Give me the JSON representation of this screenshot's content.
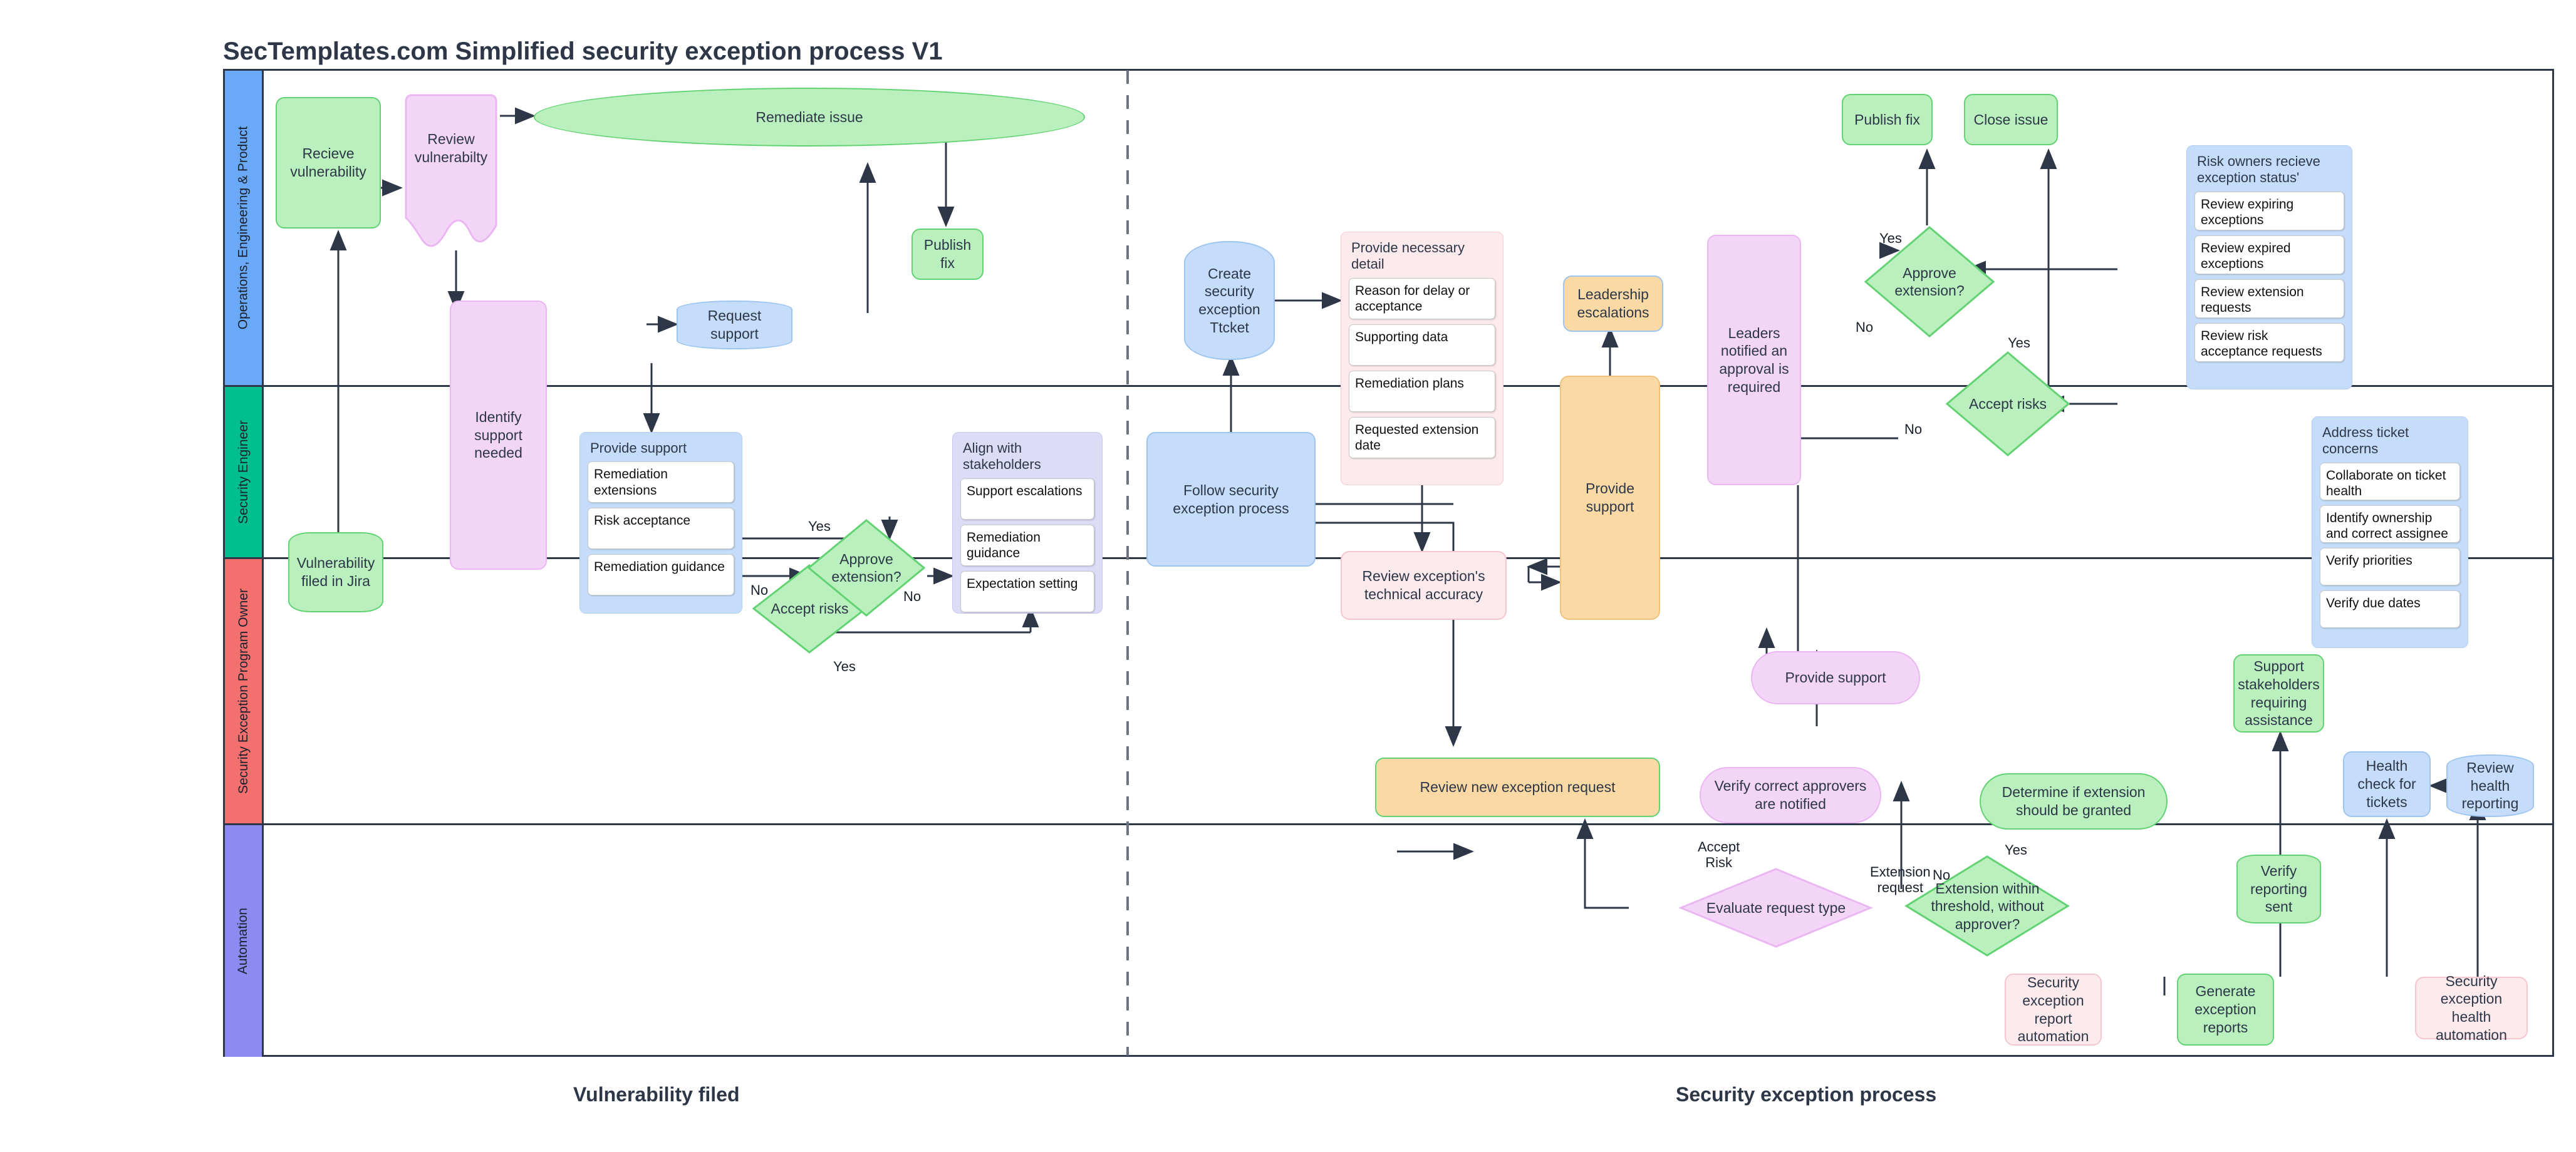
{
  "title": "SecTemplates.com Simplified security exception process V1",
  "lanes": [
    {
      "id": "ops",
      "label": "Operations, Engineering & Product",
      "color": "#6aa9f7"
    },
    {
      "id": "seceng",
      "label": "Security Engineer",
      "color": "#00bf8f"
    },
    {
      "id": "sepo",
      "label": "Security Exception Program Owner",
      "color": "#f4706e"
    },
    {
      "id": "auto",
      "label": "Automation",
      "color": "#8c8cf0"
    }
  ],
  "phases": [
    {
      "id": "phase-left",
      "label": "Vulnerability filed"
    },
    {
      "id": "phase-right",
      "label": "Security exception process"
    }
  ],
  "nodes": {
    "recieve_vulnerability": "Recieve vulnerability",
    "review_vulnerabilty": "Review vulnerabilty",
    "remediate_issue": "Remediate issue",
    "publish_fix_left": "Publish fix",
    "request_support": "Request support",
    "identify_support_needed": "Identify support needed",
    "vulnerability_filed_in_jira": "Vulnerability filed in Jira",
    "create_security_exception_ticket": "Create security exception Ttcket",
    "follow_security_exception_process": "Follow security exception process",
    "review_exceptions_technical_accuracy": "Review exception's technical accuracy",
    "leadership_escalations": "Leadership escalations",
    "provide_support_center": "Provide support",
    "leaders_notified": "Leaders notified an approval is required",
    "publish_fix_right": "Publish fix",
    "close_issue": "Close issue",
    "provide_support_oval": "Provide support",
    "review_new_exception_request": "Review new exception request",
    "verify_correct_approvers": "Verify correct approvers are notified",
    "determine_extension_granted": "Determine if extension should be granted",
    "support_stakeholders": "Support stakeholders requiring assistance",
    "verify_reporting_sent": "Verify reporting sent",
    "health_check_for_tickets": "Health check for tickets",
    "review_health_reporting": "Review health reporting",
    "security_exception_report_automation": "Security exception report automation",
    "generate_exception_reports": "Generate exception reports",
    "security_exception_health_automation": "Security exception health automation"
  },
  "decisions": {
    "approve_extension_left": "Approve extension?",
    "accept_risks_left": "Accept risks",
    "approve_extension_right": "Approve extension?",
    "accept_risks_right": "Accept risks",
    "evaluate_request_type": "Evaluate request type",
    "extension_within_threshold": "Extension within threshold, without approver?"
  },
  "groups": {
    "provide_support_list": {
      "title": "Provide support",
      "items": [
        "Remediation extensions",
        "Risk acceptance",
        "Remediation guidance"
      ]
    },
    "align_with_stakeholders": {
      "title": "Align with stakeholders",
      "items": [
        "Support escalations",
        "Remediation guidance",
        "Expectation setting"
      ]
    },
    "provide_necessary_detail": {
      "title": "Provide necessary detail",
      "items": [
        "Reason for delay or acceptance",
        "Supporting data",
        "Remediation plans",
        "Requested extension date"
      ]
    },
    "risk_owners_status": {
      "title": "Risk owners recieve exception status'",
      "items": [
        "Review expiring exceptions",
        "Review expired exceptions",
        "Review extension requests",
        "Review risk acceptance requests"
      ]
    },
    "address_ticket_concerns": {
      "title": "Address ticket concerns",
      "items": [
        "Collaborate on ticket health",
        "Identify ownership and correct assignee",
        "Verify priorities",
        "Verify due dates"
      ]
    }
  },
  "edge_labels": {
    "l_yes_1": "Yes",
    "l_no_1": "No",
    "l_no_2": "No",
    "l_yes_2": "Yes",
    "r_yes_1": "Yes",
    "r_no_1": "No",
    "r_yes_2": "Yes",
    "r_no_2": "No",
    "accept_risk": "Accept\nRisk",
    "extension_request": "Extension\nrequest",
    "no_eval": "No",
    "yes_eval": "Yes"
  },
  "colors": {
    "green_fill": "#b9f0bd",
    "green_stroke": "#62d273",
    "pink_fill": "#f3d5f7",
    "pink_stroke": "#eab7f2",
    "blue_fill": "#c5ddfa",
    "blue_stroke": "#9ec5f0",
    "orange_fill": "#fbd9a5",
    "rose_fill": "#fdeaec",
    "lane_border": "#2d3748",
    "connector": "#2d3748"
  }
}
